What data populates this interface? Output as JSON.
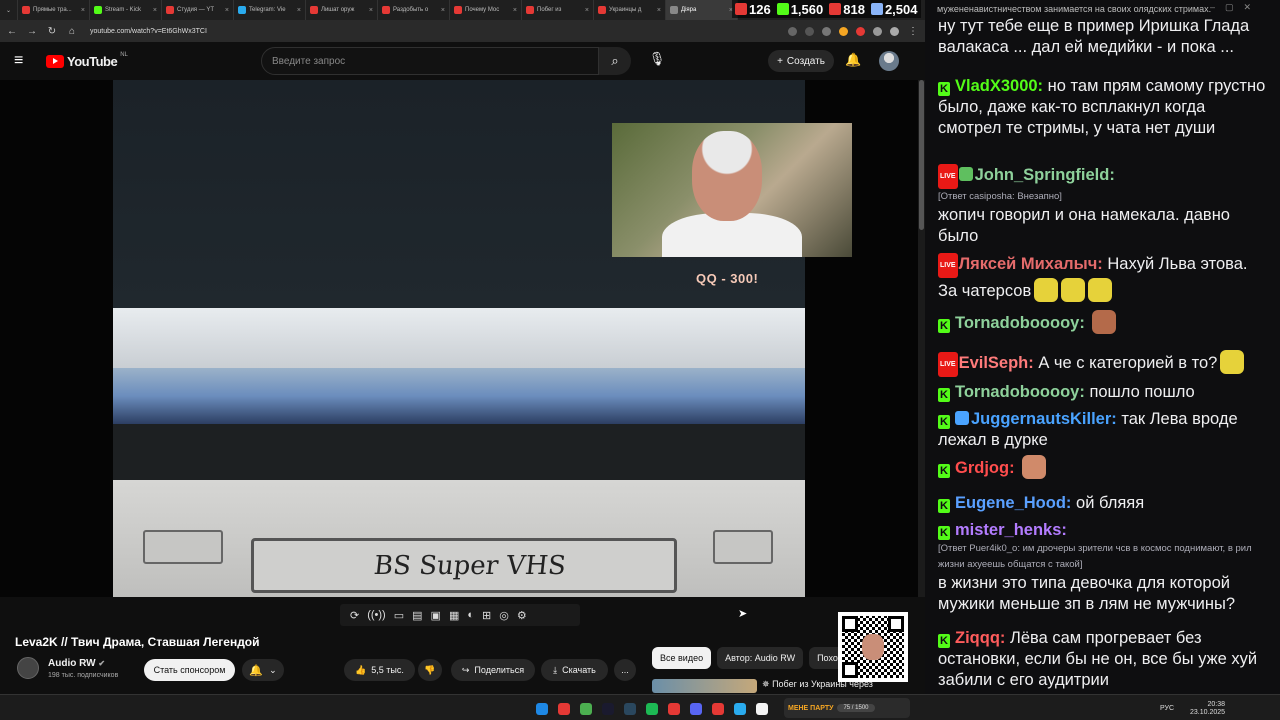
{
  "browser": {
    "tabs": [
      {
        "label": "Прямые тра...",
        "color": "#e53935"
      },
      {
        "label": "Stream - Kick",
        "color": "#53fc18"
      },
      {
        "label": "Студия — YT",
        "color": "#e53935"
      },
      {
        "label": "Telegram: Vie",
        "color": "#2aabee"
      },
      {
        "label": "Лишат оруж",
        "color": "#e53935"
      },
      {
        "label": "Раздобыть о",
        "color": "#e53935"
      },
      {
        "label": "Почему Мос",
        "color": "#e53935"
      },
      {
        "label": "Побег из",
        "color": "#e53935"
      },
      {
        "label": "Украинцы д",
        "color": "#e53935"
      },
      {
        "label": "Діяра",
        "color": "#888888"
      }
    ],
    "url": "youtube.com/watch?v=Et6GhWx3TCI"
  },
  "youtube": {
    "logo_text": "YouTube",
    "country_code": "NL",
    "search_placeholder": "Введите запрос",
    "create_label": "Создать",
    "video": {
      "overlay_text": "QQ - 300!",
      "vhs_text": "BS Super VHS",
      "controls": [
        "⟳",
        "((•))",
        "▭",
        "▤",
        "▣",
        "▦",
        "◐",
        "⊞",
        "◎",
        "⚙"
      ]
    },
    "title": "Leva2K // Твич Драма, Ставшая Легендой",
    "channel": {
      "name": "Audio RW",
      "subscribers": "198 тыс. подписчиков",
      "sponsor_label": "Стать спонсором"
    },
    "actions": {
      "likes": "5,5 тыс.",
      "share": "Поделиться",
      "download": "Скачать",
      "more": "..."
    },
    "chips": [
      "Все видео",
      "Автор: Audio RW",
      "Похож"
    ],
    "recommended_title": "Побег из Украины через"
  },
  "stream_stats": [
    {
      "icon": "youtube-icon",
      "value": "126",
      "color": "#e53935"
    },
    {
      "icon": "kick-icon",
      "value": "1,560",
      "color": "#53fc18"
    },
    {
      "icon": "live-icon",
      "value": "818",
      "color": "#e53935"
    },
    {
      "icon": "viewers-icon",
      "value": "2,504",
      "color": "#8ab4f8"
    }
  ],
  "chat": {
    "top_partial": "мужененавистничеством занимается на своих олядских стримах.",
    "messages": [
      {
        "platform": "none",
        "user": "",
        "user_color": "#efeff1",
        "reply": "",
        "text": "ну тут тебе еще в пример Иришка Глада валакаса ... дал ей медийки - и пока ..."
      },
      {
        "platform": "kick",
        "user": "VladX3000:",
        "user_color": "#53fc18",
        "reply": "",
        "text": "но там прям самому грустно было, даже как-то всплакнул когда смотрел те стримы, у чата нет души"
      },
      {
        "platform": "live",
        "user": "John_Springfield:",
        "user_color": "#8ed19b",
        "reply": "[Ответ casiposha: Внезапно]",
        "text": "жопич говорил и она намекала. давно было"
      },
      {
        "platform": "live",
        "user": "Ляксей Михалыч:",
        "user_color": "#e56b6b",
        "reply": "",
        "text": "Нахуй Льва этова. За чатерсов"
      },
      {
        "platform": "kick",
        "user": "Tornadobooooy:",
        "user_color": "#8ed19b",
        "reply": "",
        "text": ""
      },
      {
        "platform": "live",
        "user": "EvilSeph:",
        "user_color": "#ff7b7b",
        "reply": "",
        "text": "А че с категорией в то?"
      },
      {
        "platform": "kick",
        "user": "Tornadobooooy:",
        "user_color": "#8ed19b",
        "reply": "",
        "text": "пошло пошло"
      },
      {
        "platform": "kick",
        "user": "JuggernautsKiller:",
        "user_color": "#4aa3ff",
        "reply": "",
        "text": "так Лева вроде лежал в дурке"
      },
      {
        "platform": "kick",
        "user": "Grdjog:",
        "user_color": "#ff4d4d",
        "reply": "",
        "text": ""
      },
      {
        "platform": "kick",
        "user": "Eugene_Hood:",
        "user_color": "#5aa0ff",
        "reply": "",
        "text": "ой бляяя"
      },
      {
        "platform": "kick",
        "user": "mister_henks:",
        "user_color": "#b37cff",
        "reply": "[Ответ Puer4ik0_o: им дрочеры зрители чсв в космос поднимают, в рил жизни ахуеешь общатся с такой]",
        "text": "в жизни это типа девочка для которой мужики меньше зп в лям не мужчины?"
      },
      {
        "platform": "kick",
        "user": "Ziqqq:",
        "user_color": "#ff5c5c",
        "reply": "",
        "text": "Лёва сам прогревает без остановки, если бы не он, все бы уже хуй забили с его аудитрии"
      }
    ]
  },
  "taskbar": {
    "widget_title": "МЕНЕ ПАРТУ",
    "widget_counter": "75 / 1500",
    "lang": "РУС",
    "time": "20:38",
    "date": "23.10.2025"
  }
}
